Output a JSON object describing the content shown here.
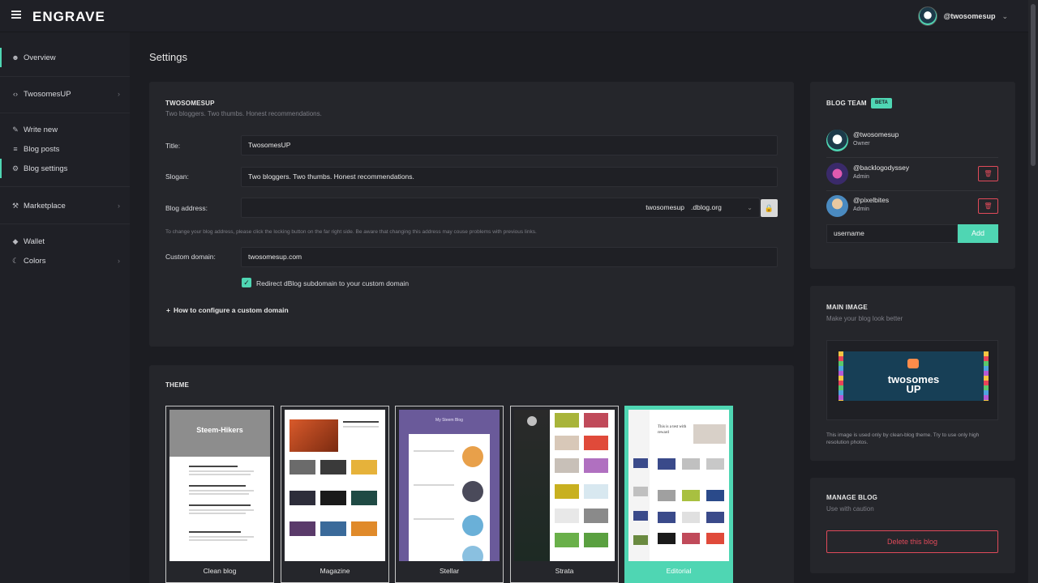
{
  "header": {
    "logo": "ENGRAVE",
    "username": "@twosomesup"
  },
  "sidebar": {
    "items": [
      {
        "label": "Overview",
        "icon": "user-icon"
      },
      {
        "label": "TwosomesUP",
        "icon": "code-icon"
      },
      {
        "label": "Write new",
        "icon": "pencil-icon"
      },
      {
        "label": "Blog posts",
        "icon": "list-icon"
      },
      {
        "label": "Blog settings",
        "icon": "gear-icon"
      },
      {
        "label": "Marketplace",
        "icon": "cart-icon"
      },
      {
        "label": "Wallet",
        "icon": "diamond-icon"
      },
      {
        "label": "Colors",
        "icon": "moon-icon"
      }
    ]
  },
  "page": {
    "title": "Settings"
  },
  "blog_card": {
    "title": "TWOSOMESUP",
    "subtitle": "Two bloggers. Two thumbs. Honest recommendations.",
    "title_label": "Title:",
    "title_value": "TwosomesUP",
    "slogan_label": "Slogan:",
    "slogan_value": "Two bloggers. Two thumbs. Honest recommendations.",
    "address_label": "Blog address:",
    "address_subdomain": "twosomesup",
    "address_domain": ".dblog.org",
    "address_help": "To change your blog address, please click the locking button on the far right side. Be aware that changing this address may couse problems with previous links.",
    "domain_label": "Custom domain:",
    "domain_value": "twosomesup.com",
    "redirect_label": "Redirect dBlog subdomain to your custom domain",
    "howto_label": "How to configure a custom domain"
  },
  "theme_card": {
    "title": "THEME",
    "themes": [
      {
        "name": "Clean blog"
      },
      {
        "name": "Magazine"
      },
      {
        "name": "Stellar"
      },
      {
        "name": "Strata"
      },
      {
        "name": "Editorial",
        "selected": true
      }
    ],
    "thumb_texts": {
      "clean_header": "Steem-Hikers",
      "stellar_header": "My Steem Blog",
      "editorial_heading": "This is a test with reward"
    }
  },
  "team_card": {
    "title": "BLOG TEAM",
    "badge": "BETA",
    "members": [
      {
        "name": "@twosomesup",
        "role": "Owner"
      },
      {
        "name": "@backlogodyssey",
        "role": "Admin"
      },
      {
        "name": "@pixelbites",
        "role": "Admin"
      }
    ],
    "input_value": "username",
    "add_label": "Add"
  },
  "image_card": {
    "title": "MAIN IMAGE",
    "subtitle": "Make your blog look better",
    "banner_line1": "twosomes",
    "banner_line2": "UP",
    "note": "This image is used only by clean-blog theme. Try to use only high resolution photos."
  },
  "manage_card": {
    "title": "MANAGE BLOG",
    "subtitle": "Use with caution",
    "delete_label": "Delete this blog"
  },
  "colors": {
    "accent": "#4fd6b3",
    "danger": "#e04a5a",
    "background": "#1c1d22",
    "card": "#25262b"
  }
}
